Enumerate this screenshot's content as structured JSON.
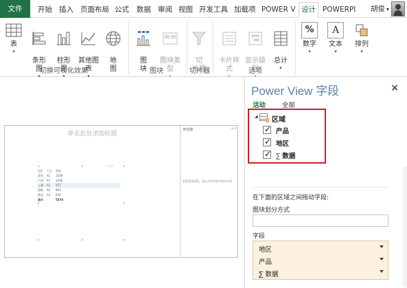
{
  "ribbon_tabs": {
    "file": "文件",
    "home": "开始",
    "insert": "插入",
    "page_layout": "页面布局",
    "formulas": "公式",
    "data": "数据",
    "review": "审阅",
    "view": "视图",
    "developer": "开发工具",
    "addins": "加载项",
    "powerview": "POWER V",
    "design": "设计",
    "powerpivot": "POWERPI"
  },
  "user": {
    "name": "胡俊",
    "chevron": "▾"
  },
  "ribbon": {
    "table": {
      "label": "表",
      "dropdown": "▾"
    },
    "bar": {
      "label": "条形\n图",
      "dropdown": "▾"
    },
    "column": {
      "label": "柱形\n图",
      "dropdown": "▾"
    },
    "other": {
      "label": "其他图\n表",
      "dropdown": "▾"
    },
    "map": {
      "label": "地\n图"
    },
    "tiles": {
      "label": "图\n块"
    },
    "tile_type": {
      "label": "图块类\n型",
      "dropdown": "▾"
    },
    "slicer": {
      "label": "切\n片器"
    },
    "card_style": {
      "label": "卡片样\n式",
      "dropdown": "▾"
    },
    "show_level": {
      "label": "显示级\n别",
      "dropdown": "▾"
    },
    "totals": {
      "label": "总计",
      "dropdown": "▾"
    },
    "number": {
      "label": "数字",
      "dropdown": "▾",
      "icon_text": "%"
    },
    "text": {
      "label": "文本",
      "dropdown": "▾",
      "icon_text": "A"
    },
    "arrange": {
      "label": "排列",
      "dropdown": "▾"
    },
    "groups": {
      "switch_visualization": "切换可视化效果",
      "tiles": "图块",
      "slicer": "切片器",
      "options": "选项"
    }
  },
  "canvas": {
    "title_placeholder": "单击此处添加标题",
    "filters_title": "筛选器",
    "filters_ctrl": "◂ ×",
    "filters_hint": "若要筛选视图，请从字段列表中拖动字段",
    "mini_ctrl": "▽ ⤢",
    "mini_table": {
      "headers": [
        "地区",
        "产品",
        "数据"
      ],
      "rows": [
        [
          "北京",
          "A1",
          "1208"
        ],
        [
          "广州",
          "A1",
          "1038"
        ],
        [
          "上海",
          "A1",
          "157"
        ],
        [
          "深圳",
          "A2",
          "893"
        ],
        [
          "武汉",
          "A1",
          "630"
        ]
      ],
      "total": [
        "总计",
        "",
        "5374"
      ]
    }
  },
  "field_pane": {
    "title_en": "Power View",
    "title_cn": "字段",
    "close": "×",
    "tab_active": "活动",
    "tab_all": "全部",
    "tree_toggle": "◢",
    "table_name": "区域",
    "fields": [
      {
        "label": "产品",
        "checked": true,
        "sigma": ""
      },
      {
        "label": "地区",
        "checked": true,
        "sigma": ""
      },
      {
        "label": "数据",
        "checked": true,
        "sigma": "∑"
      }
    ],
    "drag_hint": "在下面的区域之间拖动字段:",
    "tile_by_label": "图块划分方式",
    "fields_label": "字段",
    "field_well": [
      {
        "label": "地区",
        "sigma": ""
      },
      {
        "label": "产品",
        "sigma": ""
      },
      {
        "label": "数据",
        "sigma": "∑"
      }
    ]
  },
  "colors": {
    "accent_green": "#217346",
    "highlight_red": "#c9211e",
    "pane_title_blue": "#5b7fa7",
    "well_fill": "#fbf1de"
  }
}
